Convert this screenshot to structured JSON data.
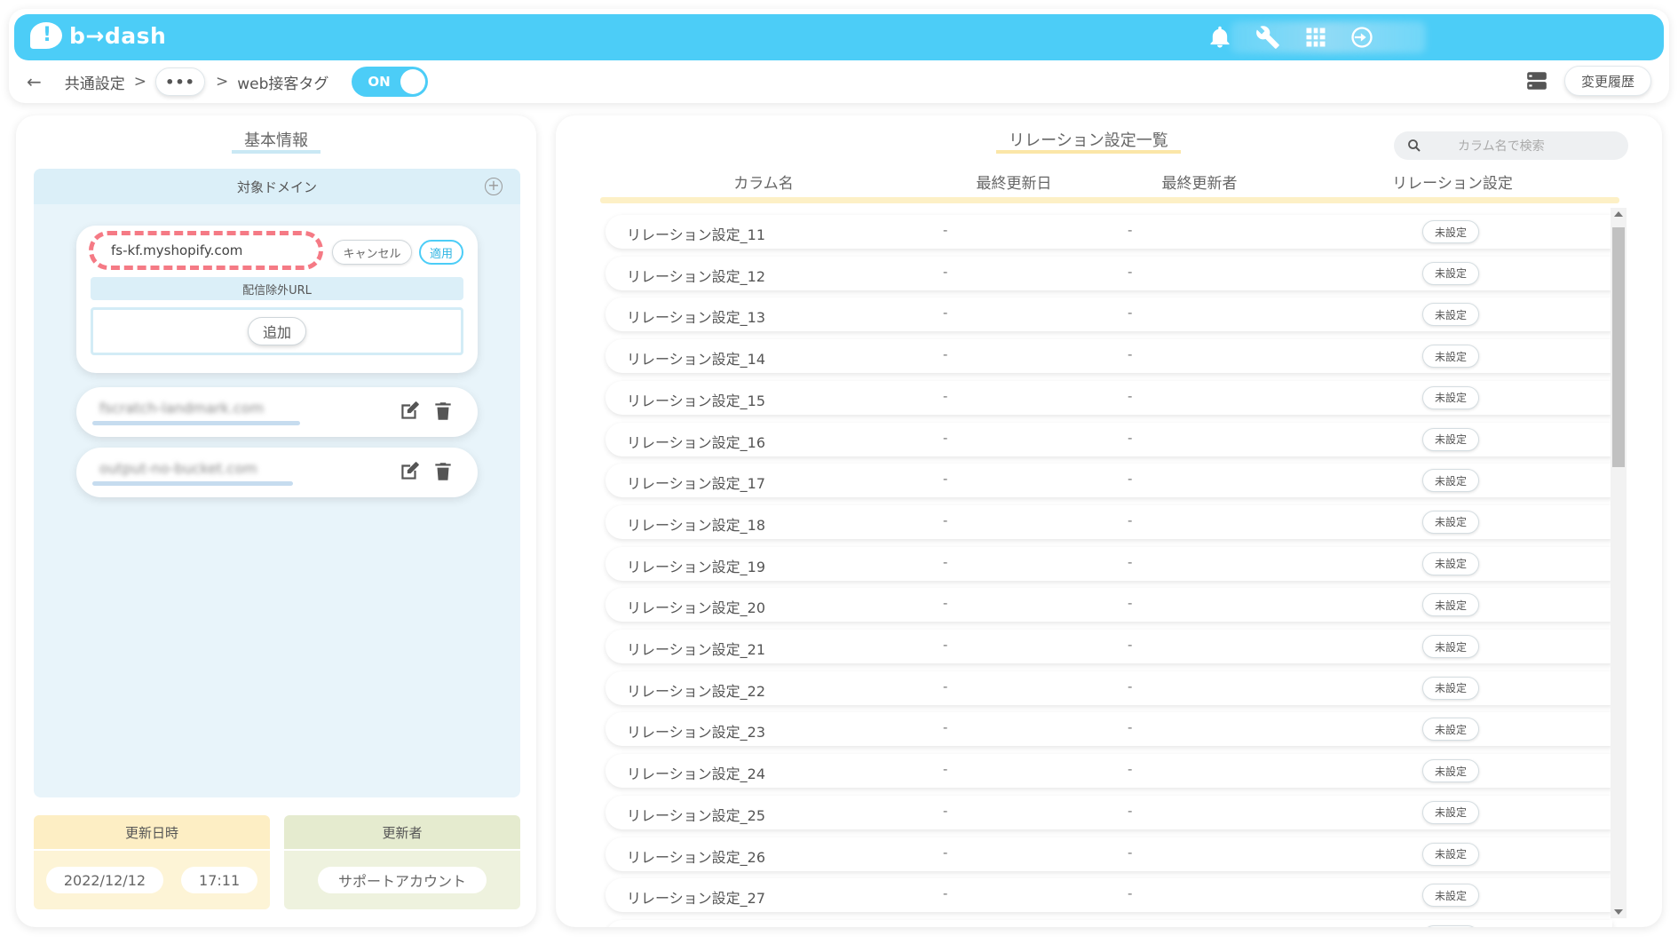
{
  "app": {
    "logo_text": "b→dash"
  },
  "header": {
    "icons": [
      "bell-icon",
      "wrench-icon",
      "apps-grid-icon",
      "logout-icon"
    ]
  },
  "breadcrumb": {
    "items": [
      "共通設定",
      "web接客タグ"
    ],
    "ellipsis": "•••",
    "separator": ">",
    "toggle_label": "ON"
  },
  "history_button": "変更履歴",
  "left": {
    "title": "基本情報",
    "domain_header": "対象ドメイン",
    "edit": {
      "value": "fs-kf.myshopify.com",
      "cancel": "キャンセル",
      "apply": "適用",
      "exclude_label": "配信除外URL",
      "add": "追加"
    },
    "domains": [
      "fscratch-landmark.com",
      "output-no-bucket.com"
    ],
    "updated_at_label": "更新日時",
    "updated_date": "2022/12/12",
    "updated_time": "17:11",
    "updater_label": "更新者",
    "updater": "サポートアカウント"
  },
  "right": {
    "title": "リレーション設定一覧",
    "search_placeholder": "カラム名で検索",
    "columns": [
      "カラム名",
      "最終更新日",
      "最終更新者",
      "リレーション設定"
    ],
    "rows": [
      {
        "name": "リレーション設定_11",
        "date": "-",
        "user": "-",
        "status": "未設定"
      },
      {
        "name": "リレーション設定_12",
        "date": "-",
        "user": "-",
        "status": "未設定"
      },
      {
        "name": "リレーション設定_13",
        "date": "-",
        "user": "-",
        "status": "未設定"
      },
      {
        "name": "リレーション設定_14",
        "date": "-",
        "user": "-",
        "status": "未設定"
      },
      {
        "name": "リレーション設定_15",
        "date": "-",
        "user": "-",
        "status": "未設定"
      },
      {
        "name": "リレーション設定_16",
        "date": "-",
        "user": "-",
        "status": "未設定"
      },
      {
        "name": "リレーション設定_17",
        "date": "-",
        "user": "-",
        "status": "未設定"
      },
      {
        "name": "リレーション設定_18",
        "date": "-",
        "user": "-",
        "status": "未設定"
      },
      {
        "name": "リレーション設定_19",
        "date": "-",
        "user": "-",
        "status": "未設定"
      },
      {
        "name": "リレーション設定_20",
        "date": "-",
        "user": "-",
        "status": "未設定"
      },
      {
        "name": "リレーション設定_21",
        "date": "-",
        "user": "-",
        "status": "未設定"
      },
      {
        "name": "リレーション設定_22",
        "date": "-",
        "user": "-",
        "status": "未設定"
      },
      {
        "name": "リレーション設定_23",
        "date": "-",
        "user": "-",
        "status": "未設定"
      },
      {
        "name": "リレーション設定_24",
        "date": "-",
        "user": "-",
        "status": "未設定"
      },
      {
        "name": "リレーション設定_25",
        "date": "-",
        "user": "-",
        "status": "未設定"
      },
      {
        "name": "リレーション設定_26",
        "date": "-",
        "user": "-",
        "status": "未設定"
      },
      {
        "name": "リレーション設定_27",
        "date": "-",
        "user": "-",
        "status": "未設定"
      },
      {
        "name": "",
        "date": "",
        "user": "",
        "status": ""
      }
    ]
  },
  "colors": {
    "accent": "#4ccdf7",
    "panel_blue": "#e8f4fa",
    "highlight_dashed": "#f57a85",
    "meta_yellow": "#fdf4d6",
    "meta_green": "#eef2de"
  }
}
